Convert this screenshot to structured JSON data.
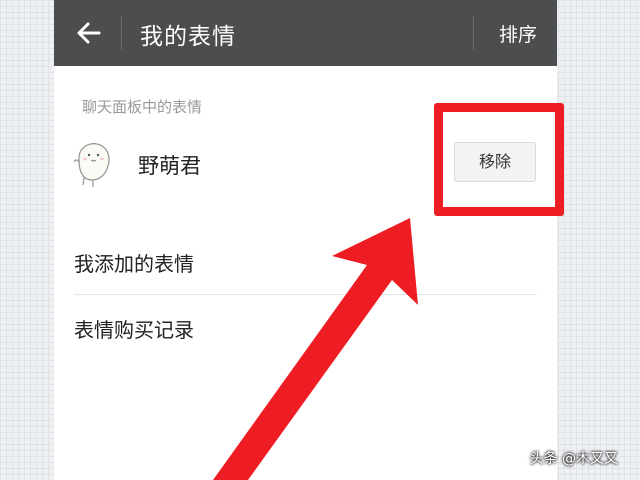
{
  "header": {
    "title": "我的表情",
    "sort_label": "排序",
    "back_icon": "arrow-left-icon"
  },
  "section": {
    "label": "聊天面板中的表情",
    "sticker": {
      "name": "野萌君",
      "remove_label": "移除",
      "avatar_icon": "cartoon-sticker-avatar"
    }
  },
  "menu": {
    "items": [
      {
        "label": "我添加的表情"
      },
      {
        "label": "表情购买记录"
      }
    ]
  },
  "annotation": {
    "color": "#ee1d23"
  },
  "watermark": {
    "text": "头条 @木又又"
  }
}
